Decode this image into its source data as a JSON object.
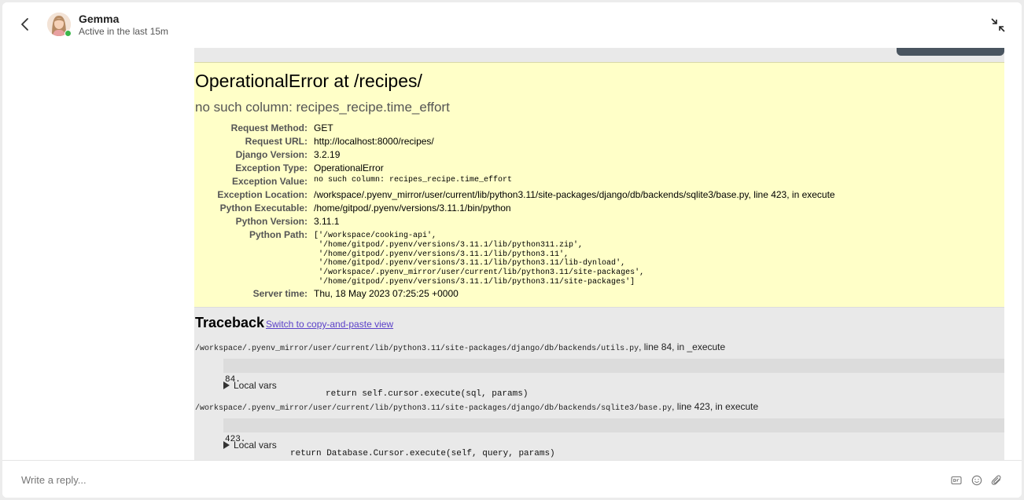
{
  "header": {
    "contact_name": "Gemma",
    "status": "Active in the last 15m"
  },
  "error_page": {
    "title": "OperationalError at /recipes/",
    "subtitle": "no such column: recipes_recipe.time_effort",
    "meta": [
      {
        "key": "Request Method:",
        "value": "GET"
      },
      {
        "key": "Request URL:",
        "value": "http://localhost:8000/recipes/"
      },
      {
        "key": "Django Version:",
        "value": "3.2.19"
      },
      {
        "key": "Exception Type:",
        "value": "OperationalError"
      },
      {
        "key": "Exception Value:",
        "value": "no such column: recipes_recipe.time_effort"
      },
      {
        "key": "Exception Location:",
        "value": "/workspace/.pyenv_mirror/user/current/lib/python3.11/site-packages/django/db/backends/sqlite3/base.py, line 423, in execute"
      },
      {
        "key": "Python Executable:",
        "value": "/home/gitpod/.pyenv/versions/3.11.1/bin/python"
      },
      {
        "key": "Python Version:",
        "value": "3.11.1"
      },
      {
        "key": "Python Path:",
        "value": "['/workspace/cooking-api',\n '/home/gitpod/.pyenv/versions/3.11.1/lib/python311.zip',\n '/home/gitpod/.pyenv/versions/3.11.1/lib/python3.11',\n '/home/gitpod/.pyenv/versions/3.11.1/lib/python3.11/lib-dynload',\n '/workspace/.pyenv_mirror/user/current/lib/python3.11/site-packages',\n '/home/gitpod/.pyenv/versions/3.11.1/lib/python3.11/site-packages']"
      },
      {
        "key": "Server time:",
        "value": "Thu, 18 May 2023 07:25:25 +0000"
      }
    ],
    "traceback": {
      "title": "Traceback",
      "link": "Switch to copy-and-paste view",
      "frames": [
        {
          "path": "/workspace/.pyenv_mirror/user/current/lib/python3.11/site-packages/django/db/backends/utils.py",
          "where": ", line 84, in _execute",
          "line_no": "84.",
          "code": "return self.cursor.execute(sql, params)",
          "local_vars": "Local vars"
        },
        {
          "path": "/workspace/.pyenv_mirror/user/current/lib/python3.11/site-packages/django/db/backends/sqlite3/base.py",
          "where": ", line 423, in execute",
          "line_no": "423.",
          "code": "return Database.Cursor.execute(self, query, params)",
          "local_vars": "Local vars"
        }
      ]
    }
  },
  "reply": {
    "placeholder": "Write a reply..."
  },
  "icons": [
    "back-icon",
    "avatar",
    "collapse-icon",
    "gif-icon",
    "emoji-icon",
    "attachment-icon"
  ]
}
